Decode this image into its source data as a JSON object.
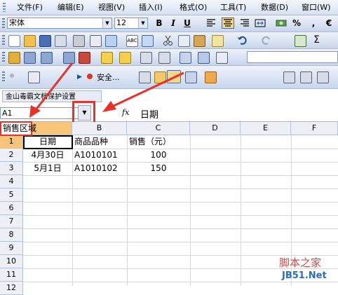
{
  "menubar": {
    "items": [
      "文件(F)",
      "编辑(E)",
      "视图(V)",
      "插入(I)",
      "格式(O)",
      "工具(T)",
      "数据(D)",
      "窗口(W)"
    ]
  },
  "format_toolbar": {
    "font_name": "宋体",
    "font_size": "12",
    "bold": "B",
    "italic": "I",
    "underline": "U",
    "percent": "%",
    "comma": ",",
    "euro": "€"
  },
  "toolbar4": {
    "security_label": "安全..."
  },
  "addin_tab": {
    "label": "金山毒霸文档保护设置"
  },
  "formula_bar": {
    "name_box": "A1",
    "fx": "fx",
    "content": "日期"
  },
  "callout": {
    "text": "销售区域"
  },
  "sheet": {
    "columns": [
      "B",
      "C",
      "D",
      "E",
      "F"
    ],
    "rows": [
      "1",
      "2",
      "3",
      "4",
      "5",
      "6",
      "7",
      "8",
      "9",
      "10",
      "11",
      "12"
    ],
    "cells": {
      "a1": "日期",
      "b1": "商品品种",
      "c1": "销售（元）",
      "a2": "4月30日",
      "b2": "A1010101",
      "c2": "100",
      "a3": "5月1日",
      "b3": "A1010102",
      "c3": "150"
    }
  },
  "watermark": {
    "line1": "脚本之家",
    "line2": "JB51.Net"
  },
  "colors": {
    "highlight_red": "#e8312a",
    "toolbar_blue": "#c9d6ec"
  }
}
